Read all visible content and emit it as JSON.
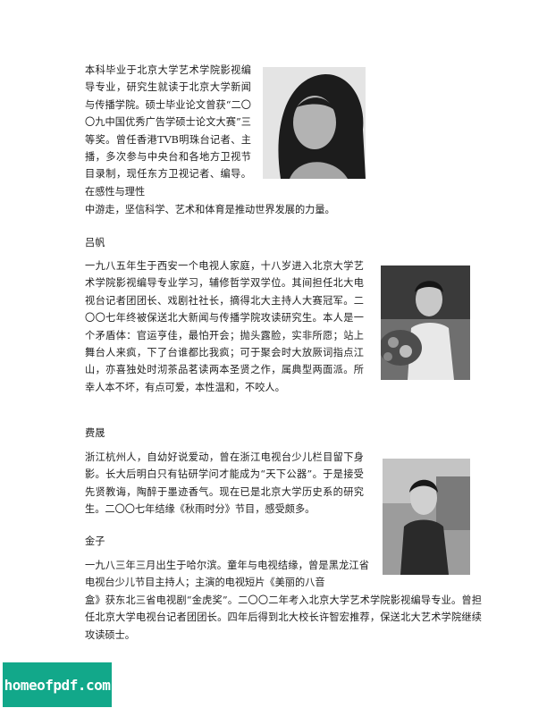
{
  "sections": [
    {
      "name": "",
      "bio": "本科毕业于北京大学艺术学院影视编导专业，研究生就读于北京大学新闻与传播学院。硕士毕业论文曾获“二〇〇九中国优秀广告学硕士论文大赛”三等奖。曾任香港TVB明珠台记者、主播，多次参与中央台和各地方卫视节目录制，现任东方卫视记者、编导。在感性与理性中游走，坚信科学、艺术和体育是推动世界发展的力量。"
    },
    {
      "name": "吕帆",
      "bio": "一九八五年生于西安一个电视人家庭，十八岁进入北京大学艺术学院影视编导专业学习，辅修哲学双学位。其间担任北大电视台记者团团长、戏剧社社长，摘得北大主持人大赛冠军。二〇〇七年终被保送北大新闻与传播学院攻读研究生。本人是一个矛盾体：官运亨佳，最怕开会；抛头露脸，实非所愿；站上舞台人来疯，下了台谁都比我疯；可于聚会时大放厥词指点江山，亦喜独处时沏茶品茗读两本圣贤之作，属典型两面派。所幸人本不坏，有点可爱，本性温和，不咬人。"
    },
    {
      "name": "费晟",
      "bio": "浙江杭州人，自幼好说爱动，曾在浙江电视台少儿栏目留下身影。长大后明白只有钻研学问才能成为“天下公器”。于是接受先贤教诲，陶醉于墨迹香气。现在已是北京大学历史系的研究生。二〇〇七年结缘《秋雨时分》节目，感受颇多。"
    },
    {
      "name": "金子",
      "bio": "一九八三年三月出生于哈尔滨。童年与电视结缘，曾是黑龙江省电视台少儿节目主持人；主演的电视短片《美丽的八音盒》获东北三省电视剧“金虎奖”。二〇〇二年考入北京大学艺术学院影视编导专业。曾担任北京大学电视台记者团团长。四年后得到北大校长许智宏推荐，保送北大艺术学院继续攻读硕士。"
    }
  ],
  "watermark": "homeofpdf.com"
}
